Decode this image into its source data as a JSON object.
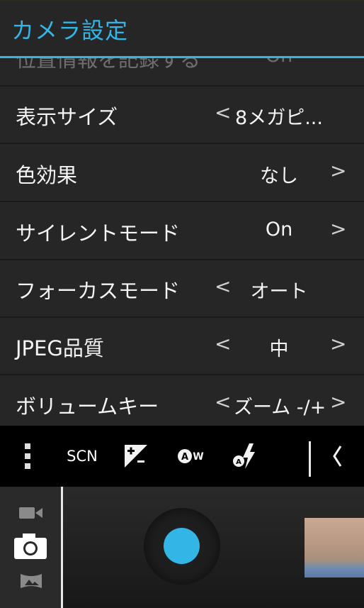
{
  "header": {
    "title": "カメラ設定"
  },
  "settings": [
    {
      "label": "位置情報を記録する",
      "value": "On",
      "left_arrow": "",
      "right_arrow": ""
    },
    {
      "label": "表示サイズ",
      "value": "8メガピ...",
      "left_arrow": "<",
      "right_arrow": ""
    },
    {
      "label": "色効果",
      "value": "なし",
      "left_arrow": "",
      "right_arrow": ">"
    },
    {
      "label": "サイレントモード",
      "value": "On",
      "left_arrow": "",
      "right_arrow": ">"
    },
    {
      "label": "フォーカスモード",
      "value": "オート",
      "left_arrow": "<",
      "right_arrow": ""
    },
    {
      "label": "JPEG品質",
      "value": "中",
      "left_arrow": "<",
      "right_arrow": ">"
    },
    {
      "label": "ボリュームキー",
      "value": "ズーム -/+",
      "left_arrow": "<",
      "right_arrow": ">"
    }
  ],
  "toolbar": {
    "scene_label": "SCN",
    "icons": [
      "more-options-icon",
      "exposure-icon",
      "white-balance-auto-icon",
      "flash-auto-icon",
      "collapse-chevron-icon"
    ]
  },
  "camera": {
    "modes": [
      "video-icon",
      "camera-icon",
      "panorama-icon"
    ],
    "accent_color": "#33b5e5"
  }
}
